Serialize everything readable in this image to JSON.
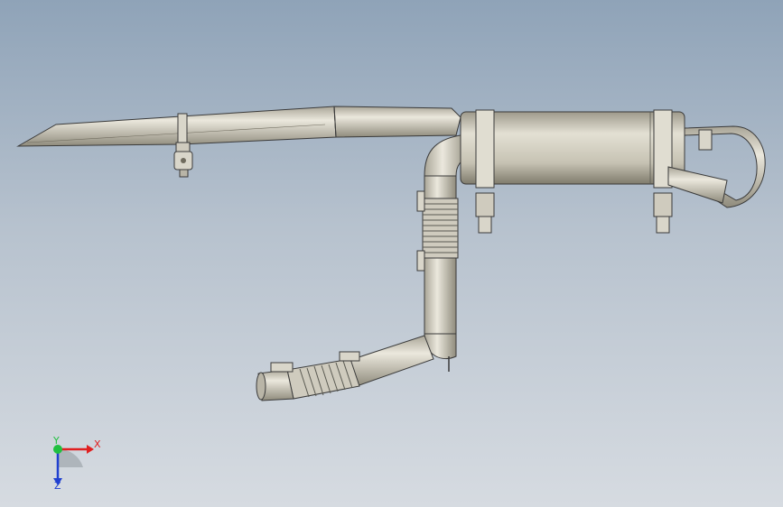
{
  "viewport": {
    "background_top": "#8fa3b8",
    "background_bottom": "#d6dbe1"
  },
  "model": {
    "name_icon": "exhaust-pipe-assembly",
    "colors": {
      "metal": "#c9c5b6",
      "metal_light": "#e6e3d8",
      "metal_dark": "#8f8b7c",
      "edge": "#3a3a3a"
    }
  },
  "triad": {
    "x_label": "X",
    "y_label": "Y",
    "z_label": "Z",
    "x_color": "#e02020",
    "y_color": "#20c040",
    "z_color": "#2040d0"
  }
}
